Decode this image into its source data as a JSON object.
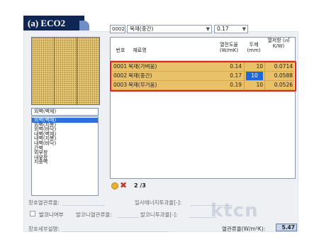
{
  "caption": {
    "label": "(a) ECO2"
  },
  "material_selector": {
    "code": "0002",
    "name": "목재(중간)",
    "thickness": "0.17"
  },
  "category_combo": {
    "value": "외벽(벽체)"
  },
  "category_list": {
    "items": [
      "외벽(벽체)",
      "외벽(지붕)",
      "외벽(바닥)",
      "내벽(벽체)",
      "내벽(지붕)",
      "내벽(바닥)",
      "간벽",
      "외부창",
      "내부창",
      "지중벽"
    ],
    "selected_index": 0
  },
  "table": {
    "headers": {
      "no": "번호",
      "name": "재료명",
      "conductivity": "열전도율 (W/mK)",
      "thickness": "두께 (mm)",
      "resistance": "열저항 (㎡ K/W)"
    },
    "rows": [
      {
        "no": "0001",
        "name": "목재(가벼움)",
        "conductivity": "0.14",
        "thickness": "10",
        "resistance": "0.0714"
      },
      {
        "no": "0002",
        "name": "목재(중간)",
        "conductivity": "0.17",
        "thickness": "10",
        "resistance": "0.0588"
      },
      {
        "no": "0003",
        "name": "목재(무거움)",
        "conductivity": "0.19",
        "thickness": "10",
        "resistance": "0.0526"
      }
    ],
    "selected_row": 1
  },
  "navigator": {
    "page": "2 /3"
  },
  "labels": {
    "window_resistance": "창호열관류율:",
    "solar_transmittance": "일사에너지투과율[-]:",
    "balcony_check": "발코니여부",
    "balcony_resistance": "발코니열관류율:",
    "balcony_transmittance": "발코니투과율[-]:",
    "window_detail": "창호세부설명:",
    "total_resistance": "열관류율(W/m²K):"
  },
  "total_value": "5.47",
  "watermark": "ktcn",
  "colors": {
    "highlight_row": "#e8c16a",
    "selection": "#1f68d9",
    "annotation_box": "#e02424",
    "caption_bg": "#0f2554"
  }
}
